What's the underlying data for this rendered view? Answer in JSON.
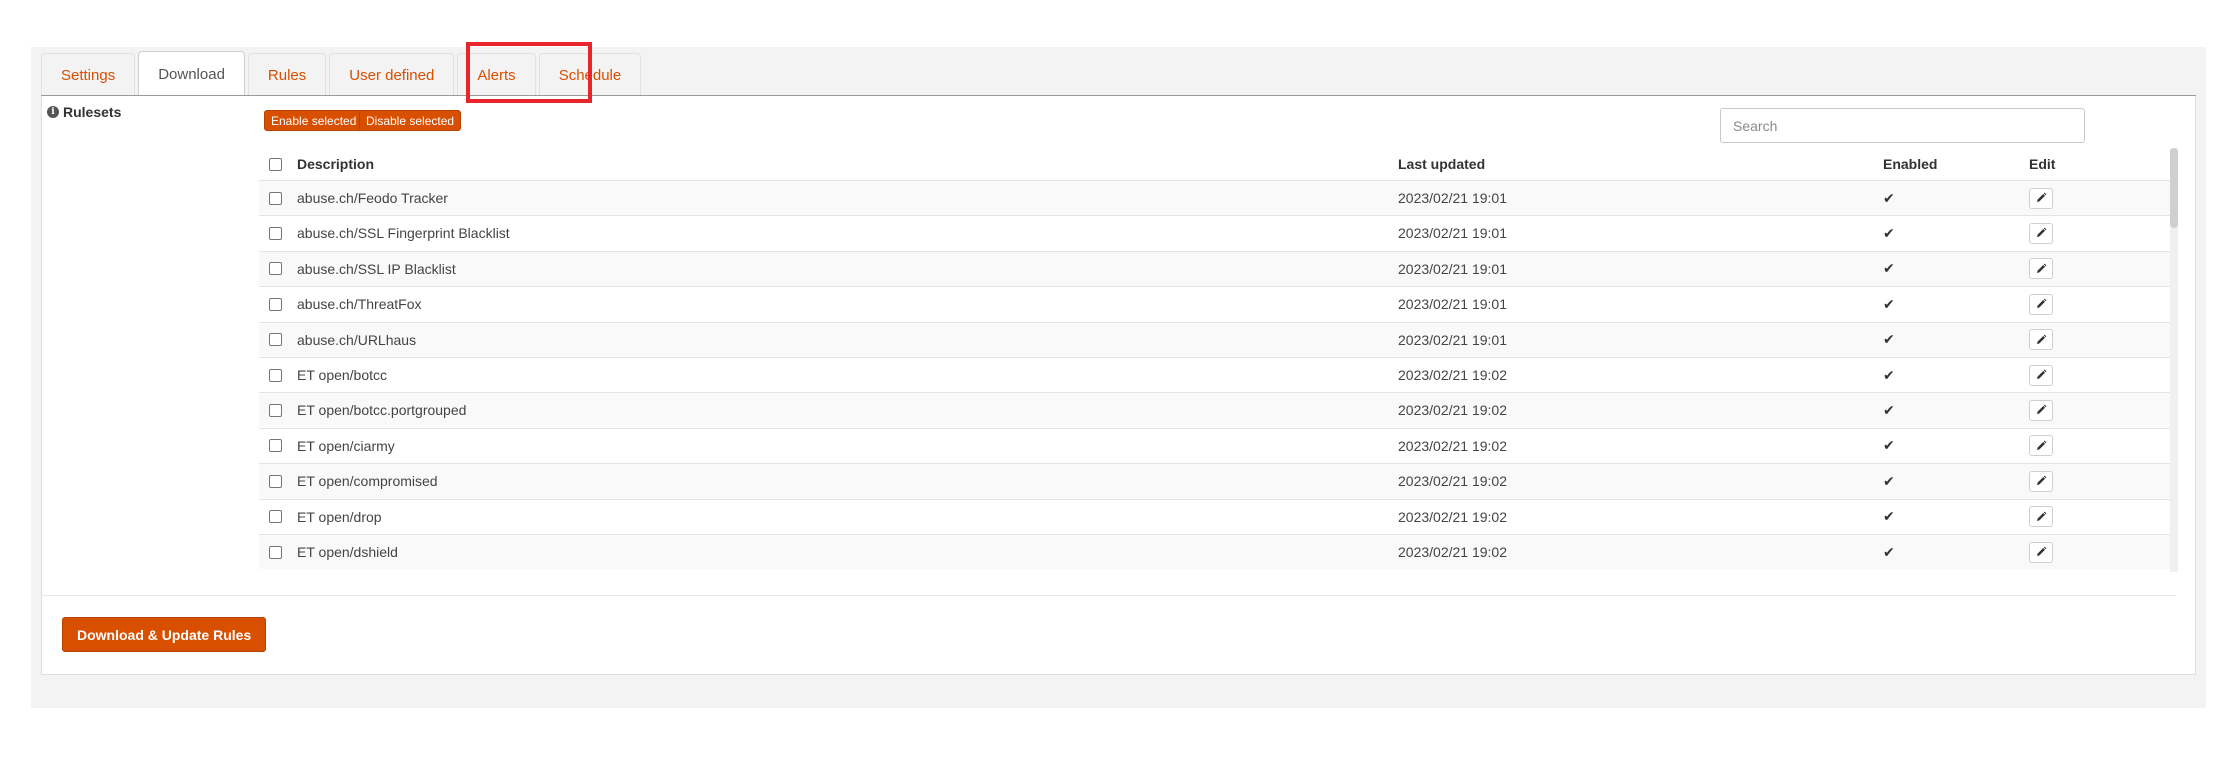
{
  "tabs": [
    {
      "label": "Settings"
    },
    {
      "label": "Download"
    },
    {
      "label": "Rules"
    },
    {
      "label": "User defined"
    },
    {
      "label": "Alerts"
    },
    {
      "label": "Schedule"
    }
  ],
  "active_tab": "Download",
  "section": {
    "label": "Rulesets",
    "icon": "info-icon"
  },
  "actions": {
    "enable_selected": "Enable selected",
    "disable_selected": "Disable selected"
  },
  "search": {
    "placeholder": "Search",
    "value": ""
  },
  "table": {
    "columns": {
      "description": "Description",
      "last_updated": "Last updated",
      "enabled": "Enabled",
      "edit": "Edit"
    },
    "rows": [
      {
        "description": "abuse.ch/Feodo Tracker",
        "last_updated": "2023/02/21 19:01",
        "enabled": "✔"
      },
      {
        "description": "abuse.ch/SSL Fingerprint Blacklist",
        "last_updated": "2023/02/21 19:01",
        "enabled": "✔"
      },
      {
        "description": "abuse.ch/SSL IP Blacklist",
        "last_updated": "2023/02/21 19:01",
        "enabled": "✔"
      },
      {
        "description": "abuse.ch/ThreatFox",
        "last_updated": "2023/02/21 19:01",
        "enabled": "✔"
      },
      {
        "description": "abuse.ch/URLhaus",
        "last_updated": "2023/02/21 19:01",
        "enabled": "✔"
      },
      {
        "description": "ET open/botcc",
        "last_updated": "2023/02/21 19:02",
        "enabled": "✔"
      },
      {
        "description": "ET open/botcc.portgrouped",
        "last_updated": "2023/02/21 19:02",
        "enabled": "✔"
      },
      {
        "description": "ET open/ciarmy",
        "last_updated": "2023/02/21 19:02",
        "enabled": "✔"
      },
      {
        "description": "ET open/compromised",
        "last_updated": "2023/02/21 19:02",
        "enabled": "✔"
      },
      {
        "description": "ET open/drop",
        "last_updated": "2023/02/21 19:02",
        "enabled": "✔"
      },
      {
        "description": "ET open/dshield",
        "last_updated": "2023/02/21 19:02",
        "enabled": "✔"
      }
    ]
  },
  "footer": {
    "download_button": "Download & Update Rules"
  },
  "colors": {
    "accent": "#d94f00",
    "highlight": "#e8252a"
  }
}
